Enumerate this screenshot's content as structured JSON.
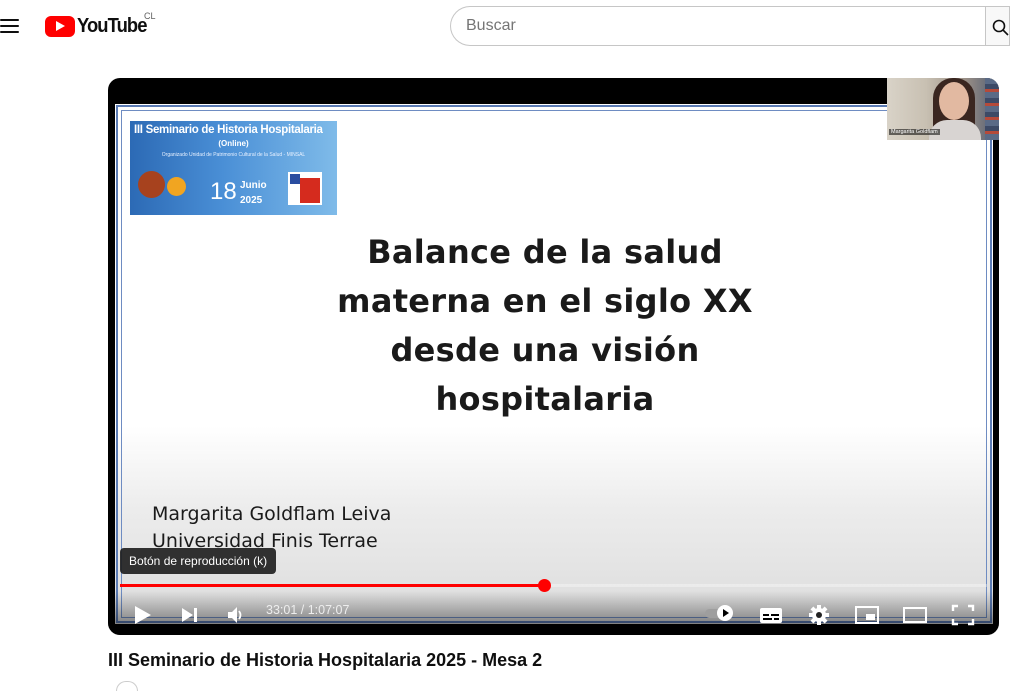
{
  "masthead": {
    "logo_text": "YouTube",
    "country_code": "CL",
    "search_placeholder": "Buscar"
  },
  "player": {
    "slide": {
      "banner_title": "III Seminario de Historia Hospitalaria",
      "banner_subtitle": "(Online)",
      "banner_org": "Organizado Unidad de Patrimonio Cultural de la Salud - MINSAL",
      "banner_day": "18",
      "banner_month": "Junio",
      "banner_year": "2025",
      "title_lines": [
        "Balance de la salud",
        "materna en el siglo XX",
        "desde una visión",
        "hospitalaria"
      ],
      "author": "Margarita Goldflam Leiva",
      "institution": "Universidad Finis Terrae"
    },
    "webcam_name": "Margarita Goldflam",
    "tooltip": "Botón de reproducción (k)",
    "progress_fraction": 0.4889,
    "time_current": "33:01",
    "time_separator": " / ",
    "time_total": "1:07:07",
    "colors": {
      "progress": "#ff0000",
      "logo": "#ff0000"
    }
  },
  "video": {
    "title": "III Seminario de Historia Hospitalaria 2025 - Mesa 2"
  }
}
